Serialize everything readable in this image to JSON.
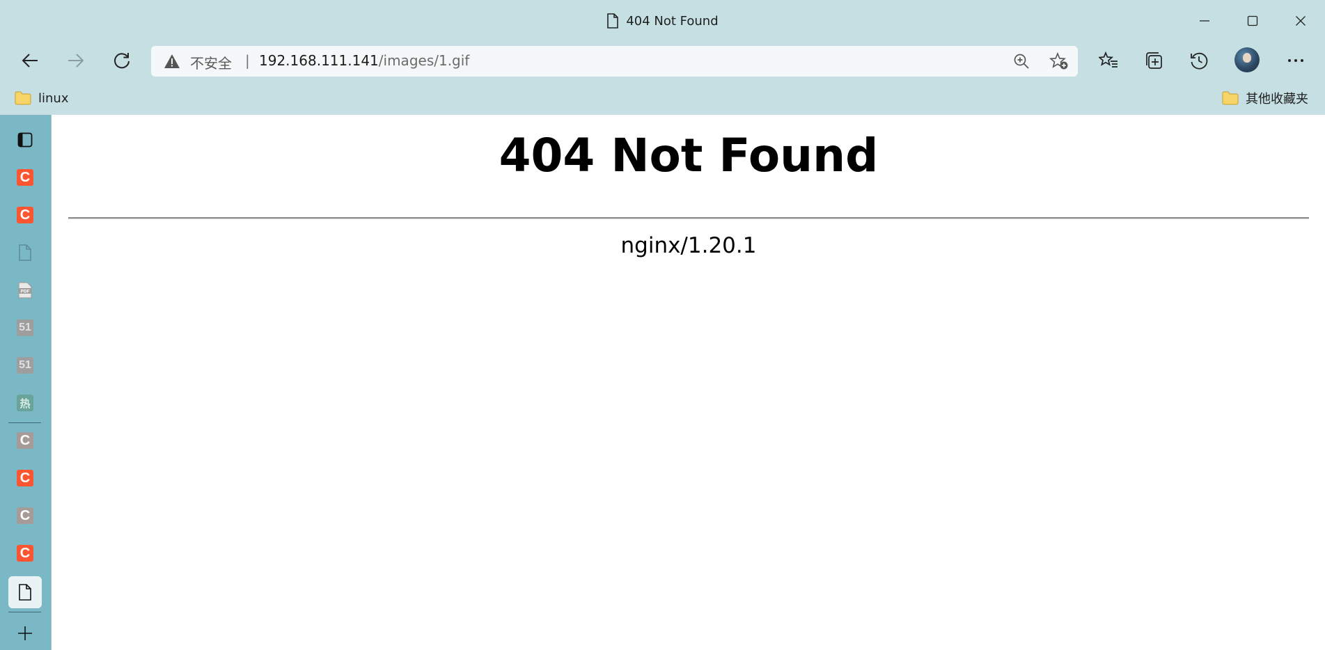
{
  "window": {
    "title": "404 Not Found",
    "icons": [
      "document-icon",
      "minimize-icon",
      "maximize-icon",
      "close-icon"
    ]
  },
  "toolbar": {
    "security_label": "不安全",
    "separator": "|",
    "url_host": "192.168.111.141",
    "url_path": "/images/1.gif",
    "icons": [
      "back-icon",
      "forward-icon",
      "refresh-icon",
      "warning-icon",
      "zoom-icon",
      "add-favorite-icon",
      "favorites-icon",
      "collections-icon",
      "history-icon",
      "profile-avatar",
      "more-icon"
    ]
  },
  "favorites": {
    "items": [
      {
        "label": "linux",
        "icon": "folder-icon"
      }
    ],
    "other": {
      "label": "其他收藏夹",
      "icon": "folder-icon"
    }
  },
  "sidebar": {
    "tabs": [
      {
        "icon": "tab-actions-icon"
      },
      {
        "icon": "csdn-icon",
        "glyph": "C",
        "state": "active"
      },
      {
        "icon": "csdn-icon",
        "glyph": "C",
        "state": "active"
      },
      {
        "icon": "document-icon"
      },
      {
        "icon": "pdf-icon"
      },
      {
        "icon": "51cto-icon",
        "glyph": "51"
      },
      {
        "icon": "51cto-icon",
        "glyph": "51"
      },
      {
        "icon": "hot-icon",
        "glyph": "热"
      },
      {
        "icon": "csdn-icon",
        "glyph": "C",
        "state": "dim"
      },
      {
        "icon": "csdn-icon",
        "glyph": "C",
        "state": "active"
      },
      {
        "icon": "csdn-icon",
        "glyph": "C",
        "state": "dim"
      },
      {
        "icon": "csdn-icon",
        "glyph": "C",
        "state": "active"
      },
      {
        "icon": "document-icon",
        "state": "selected"
      }
    ],
    "new_tab_icon": "plus-icon",
    "colors": {
      "background": "#7bb8c6",
      "csdn": "#fc5531"
    }
  },
  "page": {
    "heading": "404 Not Found",
    "server": "nginx/1.20.1"
  },
  "colors": {
    "chrome": "#c5dfe3",
    "address_bar": "#f4f8f9"
  }
}
